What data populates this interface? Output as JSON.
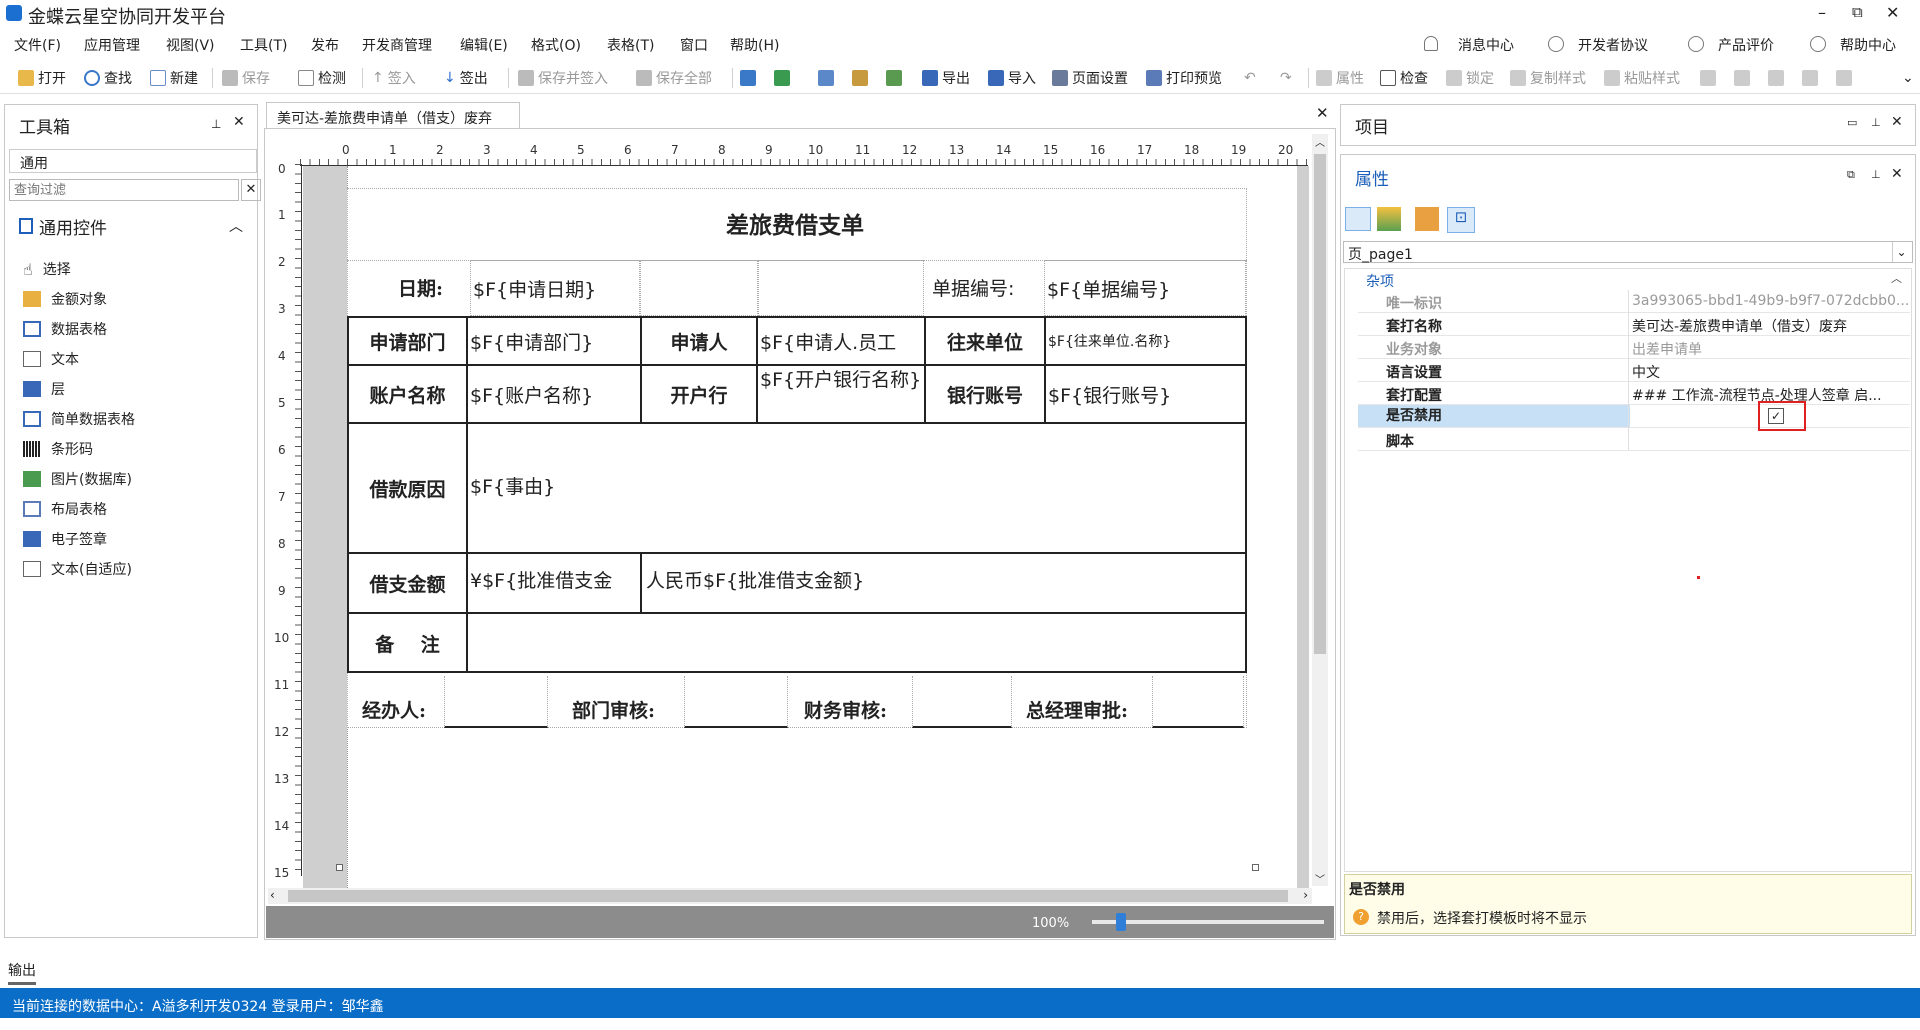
{
  "app": {
    "title": "金蝶云星空协同开发平台"
  },
  "window_controls": {
    "minimize": "–",
    "restore": "⧉",
    "close": "✕"
  },
  "menu": {
    "items": [
      "文件(F)",
      "应用管理",
      "视图(V)",
      "工具(T)",
      "发布",
      "开发商管理",
      "编辑(E)",
      "格式(O)",
      "表格(T)",
      "窗口",
      "帮助(H)"
    ],
    "right": [
      "消息中心",
      "开发者协议",
      "产品评价",
      "帮助中心"
    ]
  },
  "toolbar": {
    "open": "打开",
    "find": "查找",
    "new": "新建",
    "save": "保存",
    "check": "检测",
    "checkin": "签入",
    "checkout": "签出",
    "save_checkin": "保存并签入",
    "save_all": "保存全部",
    "export": "导出",
    "import": "导入",
    "page_setup": "页面设置",
    "print_preview": "打印预览",
    "property": "属性",
    "inspect": "检查",
    "lock": "锁定",
    "copy_style": "复制样式",
    "paste_style": "粘贴样式"
  },
  "toolbox": {
    "title": "工具箱",
    "tab": "通用",
    "filter_placeholder": "查询过滤",
    "group": "通用控件",
    "items": [
      "选择",
      "金额对象",
      "数据表格",
      "文本",
      "层",
      "简单数据表格",
      "条形码",
      "图片(数据库)",
      "布局表格",
      "电子签章",
      "文本(自适应)"
    ]
  },
  "document": {
    "tab_title": "美可达-差旅费申请单（借支）废弃",
    "zoom": "100%",
    "ruler_top": [
      "0",
      "1",
      "2",
      "3",
      "4",
      "5",
      "6",
      "7",
      "8",
      "9",
      "10",
      "11",
      "12",
      "13",
      "14",
      "15",
      "16",
      "17",
      "18",
      "19",
      "20"
    ],
    "ruler_left": [
      "0",
      "1",
      "2",
      "3",
      "4",
      "5",
      "6",
      "7",
      "8",
      "9",
      "10",
      "11",
      "12",
      "13",
      "14",
      "15"
    ]
  },
  "form": {
    "title": "差旅费借支单",
    "date_label": "日期:",
    "date_value": "$F{申请日期}",
    "billno_label": "单据编号:",
    "billno_value": "$F{单据编号}",
    "dept_label": "申请部门",
    "dept_value": "$F{申请部门}",
    "applicant_label": "申请人",
    "applicant_value": "$F{申请人.员工",
    "contact_label": "往来单位",
    "contact_value": "$F{往来单位.名称}",
    "account_name_label": "账户名称",
    "account_name_value": "$F{账户名称}",
    "bank_label": "开户行",
    "bank_value": "$F{开户银行名称}",
    "account_no_label": "银行账号",
    "account_no_value": "$F{银行账号}",
    "reason_label": "借款原因",
    "reason_value": "$F{事由}",
    "amount_label": "借支金额",
    "amount_value": "¥$F{批准借支金",
    "amount_cn_value": "人民币$F{批准借支金额}",
    "remark_label": "备    注",
    "handler_label": "经办人:",
    "dept_review_label": "部门审核:",
    "finance_review_label": "财务审核:",
    "gm_approve_label": "总经理审批:"
  },
  "project_panel": {
    "title": "项目"
  },
  "properties": {
    "title": "属性",
    "selector": "页_page1",
    "category": "杂项",
    "rows": [
      {
        "name": "唯一标识",
        "value": "3a993065-bbd1-49b9-b9f7-072dcbb0..."
      },
      {
        "name": "套打名称",
        "value": "美可达-差旅费申请单（借支）废弃"
      },
      {
        "name": "业务对象",
        "value": "出差申请单"
      },
      {
        "name": "语言设置",
        "value": "中文"
      },
      {
        "name": "套打配置",
        "value": "### 工作流-流程节点-处理人签章 启..."
      },
      {
        "name": "是否禁用",
        "value": "✓"
      },
      {
        "name": "脚本",
        "value": ""
      }
    ],
    "help_title": "是否禁用",
    "help_text": "禁用后，选择套打模板时将不显示"
  },
  "output": {
    "tab": "输出"
  },
  "status": {
    "text": "当前连接的数据中心：A溢多利开发0324  登录用户：邹华鑫"
  }
}
